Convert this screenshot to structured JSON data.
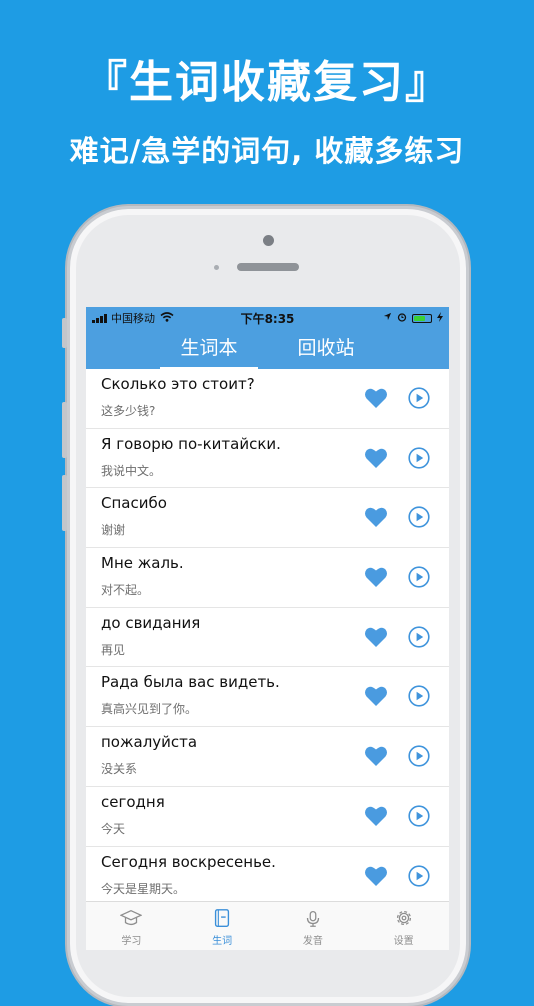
{
  "promo": {
    "title": "『生词收藏复习』",
    "subtitle": "难记/急学的词句, 收藏多练习"
  },
  "status_bar": {
    "carrier": "中国移动",
    "time": "下午8:35"
  },
  "nav": {
    "tabs": [
      {
        "label": "生词本",
        "active": true
      },
      {
        "label": "回收站",
        "active": false
      }
    ]
  },
  "words": [
    {
      "phrase": "Сколько это стоит?",
      "translation": "这多少钱?"
    },
    {
      "phrase": "Я говорю по-китайски.",
      "translation": "我说中文。"
    },
    {
      "phrase": "Спасибо",
      "translation": "谢谢"
    },
    {
      "phrase": "Мне жаль.",
      "translation": "对不起。"
    },
    {
      "phrase": "до свидания",
      "translation": "再见"
    },
    {
      "phrase": "Рада была вас видеть.",
      "translation": "真高兴见到了你。"
    },
    {
      "phrase": "пожалуйста",
      "translation": "没关系"
    },
    {
      "phrase": "сегодня",
      "translation": "今天"
    },
    {
      "phrase": "Сегодня воскресенье.",
      "translation": "今天是星期天。"
    }
  ],
  "tab_bar": {
    "items": [
      {
        "label": "学习",
        "icon": "graduation-cap-icon",
        "active": false
      },
      {
        "label": "生词",
        "icon": "notebook-icon",
        "active": true
      },
      {
        "label": "发音",
        "icon": "microphone-icon",
        "active": false
      },
      {
        "label": "设置",
        "icon": "gear-icon",
        "active": false
      }
    ]
  },
  "colors": {
    "background": "#1e9ce4",
    "nav_blue": "#4c9fe0",
    "heart": "#4a9be0",
    "play": "#3f94dc"
  }
}
